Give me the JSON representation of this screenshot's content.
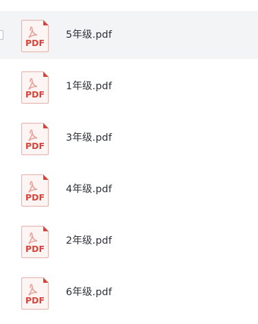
{
  "files": [
    {
      "name": "5年级.pdf",
      "icon": "pdf-file-icon",
      "icon_text": "PDF",
      "selected": true
    },
    {
      "name": "1年级.pdf",
      "icon": "pdf-file-icon",
      "icon_text": "PDF",
      "selected": false
    },
    {
      "name": "3年级.pdf",
      "icon": "pdf-file-icon",
      "icon_text": "PDF",
      "selected": false
    },
    {
      "name": "4年级.pdf",
      "icon": "pdf-file-icon",
      "icon_text": "PDF",
      "selected": false
    },
    {
      "name": "2年级.pdf",
      "icon": "pdf-file-icon",
      "icon_text": "PDF",
      "selected": false
    },
    {
      "name": "6年级.pdf",
      "icon": "pdf-file-icon",
      "icon_text": "PDF",
      "selected": false
    }
  ],
  "colors": {
    "pdf_red": "#d9443a",
    "icon_border": "#e3b7b2",
    "icon_fill": "#fdf5f4",
    "selected_row": "#f3f4f6",
    "text": "#2b2f36"
  }
}
